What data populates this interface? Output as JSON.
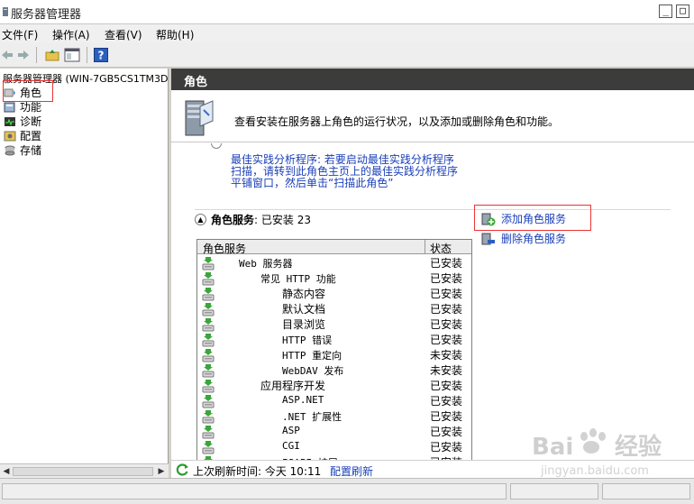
{
  "window": {
    "title": "服务器管理器"
  },
  "menu": [
    "文件(F)",
    "操作(A)",
    "查看(V)",
    "帮助(H)"
  ],
  "tree": {
    "root": "服务器管理器 (WIN-7GB5CS1TM3D)",
    "items": [
      "角色",
      "功能",
      "诊断",
      "配置",
      "存储"
    ]
  },
  "header": {
    "title": "角色"
  },
  "summary": {
    "text": "查看安装在服务器上角色的运行状况，以及添加或删除角色和功能。"
  },
  "bpa": {
    "lines": [
      "最佳实践分析程序: 若要启动最佳实践分析程序",
      "扫描，请转到此角色主页上的最佳实践分析程序",
      "平铺窗口，然后单击“扫描此角色”"
    ]
  },
  "role_services": {
    "section_label": "角色服务",
    "status_summary": ": 已安装 23",
    "columns": [
      "角色服务",
      "状态"
    ],
    "rows": [
      {
        "name": "Web 服务器",
        "status": "已安装",
        "indent": 0,
        "mono": true
      },
      {
        "name": "常见 HTTP 功能",
        "status": "已安装",
        "indent": 1,
        "mono": true
      },
      {
        "name": "静态内容",
        "status": "已安装",
        "indent": 2,
        "mono": false
      },
      {
        "name": "默认文档",
        "status": "已安装",
        "indent": 2,
        "mono": false
      },
      {
        "name": "目录浏览",
        "status": "已安装",
        "indent": 2,
        "mono": false
      },
      {
        "name": "HTTP 错误",
        "status": "已安装",
        "indent": 2,
        "mono": true
      },
      {
        "name": "HTTP 重定向",
        "status": "未安装",
        "indent": 2,
        "mono": true
      },
      {
        "name": "WebDAV 发布",
        "status": "未安装",
        "indent": 2,
        "mono": true
      },
      {
        "name": "应用程序开发",
        "status": "已安装",
        "indent": 1,
        "mono": false
      },
      {
        "name": "ASP.NET",
        "status": "已安装",
        "indent": 2,
        "mono": true
      },
      {
        "name": ".NET 扩展性",
        "status": "已安装",
        "indent": 2,
        "mono": true
      },
      {
        "name": "ASP",
        "status": "已安装",
        "indent": 2,
        "mono": true
      },
      {
        "name": "CGI",
        "status": "已安装",
        "indent": 2,
        "mono": true
      },
      {
        "name": "ISAPI 扩展",
        "status": "已安装",
        "indent": 2,
        "mono": true
      }
    ]
  },
  "actions": {
    "add": "添加角色服务",
    "remove": "删除角色服务"
  },
  "refresh": {
    "label": "上次刷新时间: 今天 10:11",
    "link": "配置刷新"
  },
  "watermark": {
    "text": "Baidu经验",
    "sub": "jingyan.baidu.com"
  },
  "colors": {
    "link": "#1a3fb8",
    "header": "#3c3c3c",
    "highlight_box": "#e33333"
  }
}
